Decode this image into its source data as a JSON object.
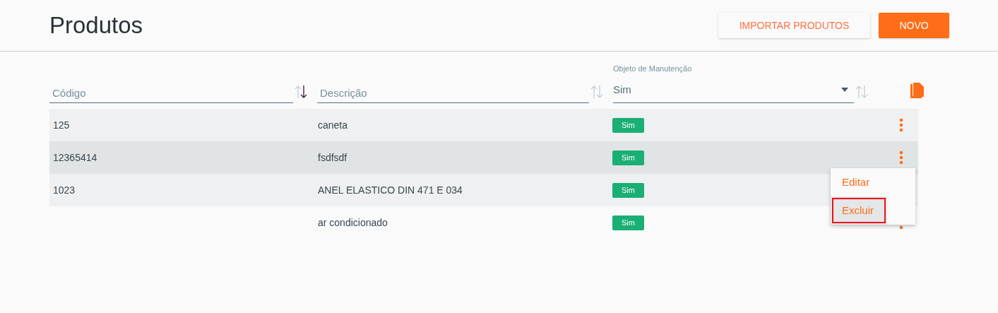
{
  "header": {
    "title": "Produtos",
    "buttons": [
      {
        "label": "IMPORTAR PRODUTOS",
        "kind": "outline"
      },
      {
        "label": "NOVO",
        "kind": "primary"
      }
    ]
  },
  "filters": [
    {
      "kind": "text",
      "placeholder": "Código",
      "sorted": true
    },
    {
      "kind": "text",
      "placeholder": "Descrição",
      "sorted": false
    },
    {
      "kind": "select",
      "label": "Objeto de Manutenção",
      "value": "Sim",
      "sorted": false
    }
  ],
  "rows": [
    {
      "code": "125",
      "description": "caneta",
      "status": "Sim",
      "selected": false
    },
    {
      "code": "12365414",
      "description": "fsdfsdf",
      "status": "Sim",
      "selected": true
    },
    {
      "code": "1023",
      "description": "ANEL ELASTICO DIN 471 E 034",
      "status": "Sim",
      "selected": false
    },
    {
      "description": "ar condicionado",
      "status": "Sim",
      "selected": false
    }
  ],
  "row_menu": {
    "items": [
      {
        "label": "Editar",
        "selected": false
      },
      {
        "label": "Excluir",
        "selected": true
      }
    ]
  }
}
